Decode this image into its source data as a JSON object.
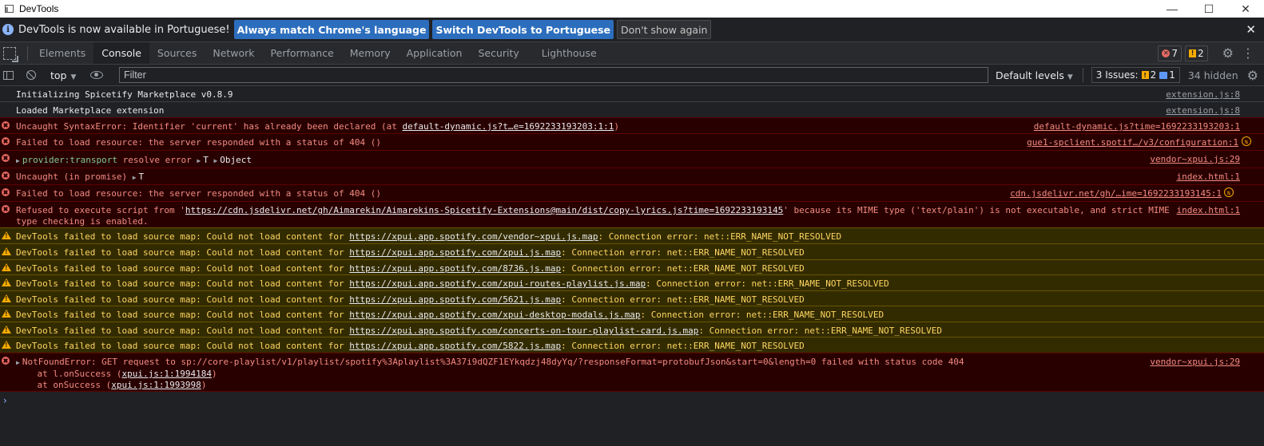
{
  "window": {
    "title": "DevTools",
    "minimize": "—",
    "maximize": "☐",
    "close": "✕"
  },
  "infobar": {
    "message": "DevTools is now available in Portuguese!",
    "btn_match": "Always match Chrome's language",
    "btn_switch": "Switch DevTools to Portuguese",
    "btn_dismiss": "Don't show again",
    "close": "✕"
  },
  "tabs": [
    {
      "label": "Elements"
    },
    {
      "label": "Console"
    },
    {
      "label": "Sources"
    },
    {
      "label": "Network"
    },
    {
      "label": "Performance"
    },
    {
      "label": "Memory"
    },
    {
      "label": "Application"
    },
    {
      "label": "Security"
    },
    {
      "label": "Lighthouse"
    }
  ],
  "counts": {
    "errors": "7",
    "warnings": "2"
  },
  "toolbar": {
    "context": "top",
    "filter_placeholder": "Filter",
    "levels": "Default levels",
    "issues_label": "3 Issues:",
    "issues_warn": "2",
    "issues_info": "1",
    "hidden": "34 hidden"
  },
  "messages": [
    {
      "type": "plain",
      "text": "Initializing Spicetify Marketplace v0.8.9",
      "src": "extension.js:8"
    },
    {
      "type": "plain",
      "text": "Loaded Marketplace extension",
      "src": "extension.js:8"
    },
    {
      "type": "error",
      "pre": "Uncaught SyntaxError: Identifier 'current' has already been declared (at ",
      "link": "default-dynamic.js?t…e=1692233193203:1:1",
      "post": ")",
      "src": "default-dynamic.js?time=1692233193203:1"
    },
    {
      "type": "error",
      "text": "Failed to load resource: the server responded with a status of 404 ()",
      "src": "gue1-spclient.spotif…/v3/configuration:1"
    },
    {
      "type": "error",
      "prov": "provider:transport",
      "text2": " resolve error ",
      "t": "T",
      "obj": "Object",
      "src": "vendor~xpui.js:29"
    },
    {
      "type": "error",
      "text": "Uncaught (in promise) ",
      "t": "T",
      "src": "index.html:1"
    },
    {
      "type": "error",
      "text": "Failed to load resource: the server responded with a status of 404 ()",
      "src": "cdn.jsdelivr.net/gh/…ime=1692233193145:1"
    },
    {
      "type": "error",
      "pre": "Refused to execute script from '",
      "link": "https://cdn.jsdelivr.net/gh/Aimarekin/Aimarekins-Spicetify-Extensions@main/dist/copy-lyrics.js?time=1692233193145",
      "post": "' because its MIME type ('text/plain') is not executable, and strict MIME",
      "line2": "type checking is enabled.",
      "src": "index.html:1"
    },
    {
      "type": "warn",
      "pre": "DevTools failed to load source map: Could not load content for ",
      "link": "https://xpui.app.spotify.com/vendor~xpui.js.map",
      "post": ": Connection error: net::ERR_NAME_NOT_RESOLVED"
    },
    {
      "type": "warn",
      "pre": "DevTools failed to load source map: Could not load content for ",
      "link": "https://xpui.app.spotify.com/xpui.js.map",
      "post": ": Connection error: net::ERR_NAME_NOT_RESOLVED"
    },
    {
      "type": "warn",
      "pre": "DevTools failed to load source map: Could not load content for ",
      "link": "https://xpui.app.spotify.com/8736.js.map",
      "post": ": Connection error: net::ERR_NAME_NOT_RESOLVED"
    },
    {
      "type": "warn",
      "pre": "DevTools failed to load source map: Could not load content for ",
      "link": "https://xpui.app.spotify.com/xpui-routes-playlist.js.map",
      "post": ": Connection error: net::ERR_NAME_NOT_RESOLVED"
    },
    {
      "type": "warn",
      "pre": "DevTools failed to load source map: Could not load content for ",
      "link": "https://xpui.app.spotify.com/5621.js.map",
      "post": ": Connection error: net::ERR_NAME_NOT_RESOLVED"
    },
    {
      "type": "warn",
      "pre": "DevTools failed to load source map: Could not load content for ",
      "link": "https://xpui.app.spotify.com/xpui-desktop-modals.js.map",
      "post": ": Connection error: net::ERR_NAME_NOT_RESOLVED"
    },
    {
      "type": "warn",
      "pre": "DevTools failed to load source map: Could not load content for ",
      "link": "https://xpui.app.spotify.com/concerts-on-tour-playlist-card.js.map",
      "post": ": Connection error: net::ERR_NAME_NOT_RESOLVED"
    },
    {
      "type": "warn",
      "pre": "DevTools failed to load source map: Could not load content for ",
      "link": "https://xpui.app.spotify.com/5822.js.map",
      "post": ": Connection error: net::ERR_NAME_NOT_RESOLVED"
    },
    {
      "type": "error",
      "text": "NotFoundError: GET request to sp://core-playlist/v1/playlist/spotify%3Aplaylist%3A37i9dQZF1EYkqdzj48dyYq/?responseFormat=protobufJson&start=0&length=0 failed with status code 404",
      "stack1_pre": "    at l.onSuccess (",
      "stack1_link": "xpui.js:1:1994184",
      "stack2_pre": "    at onSuccess (",
      "stack2_link": "xpui.js:1:1993998",
      "close": ")",
      "src": "vendor~xpui.js:29"
    }
  ],
  "prompt": "›"
}
